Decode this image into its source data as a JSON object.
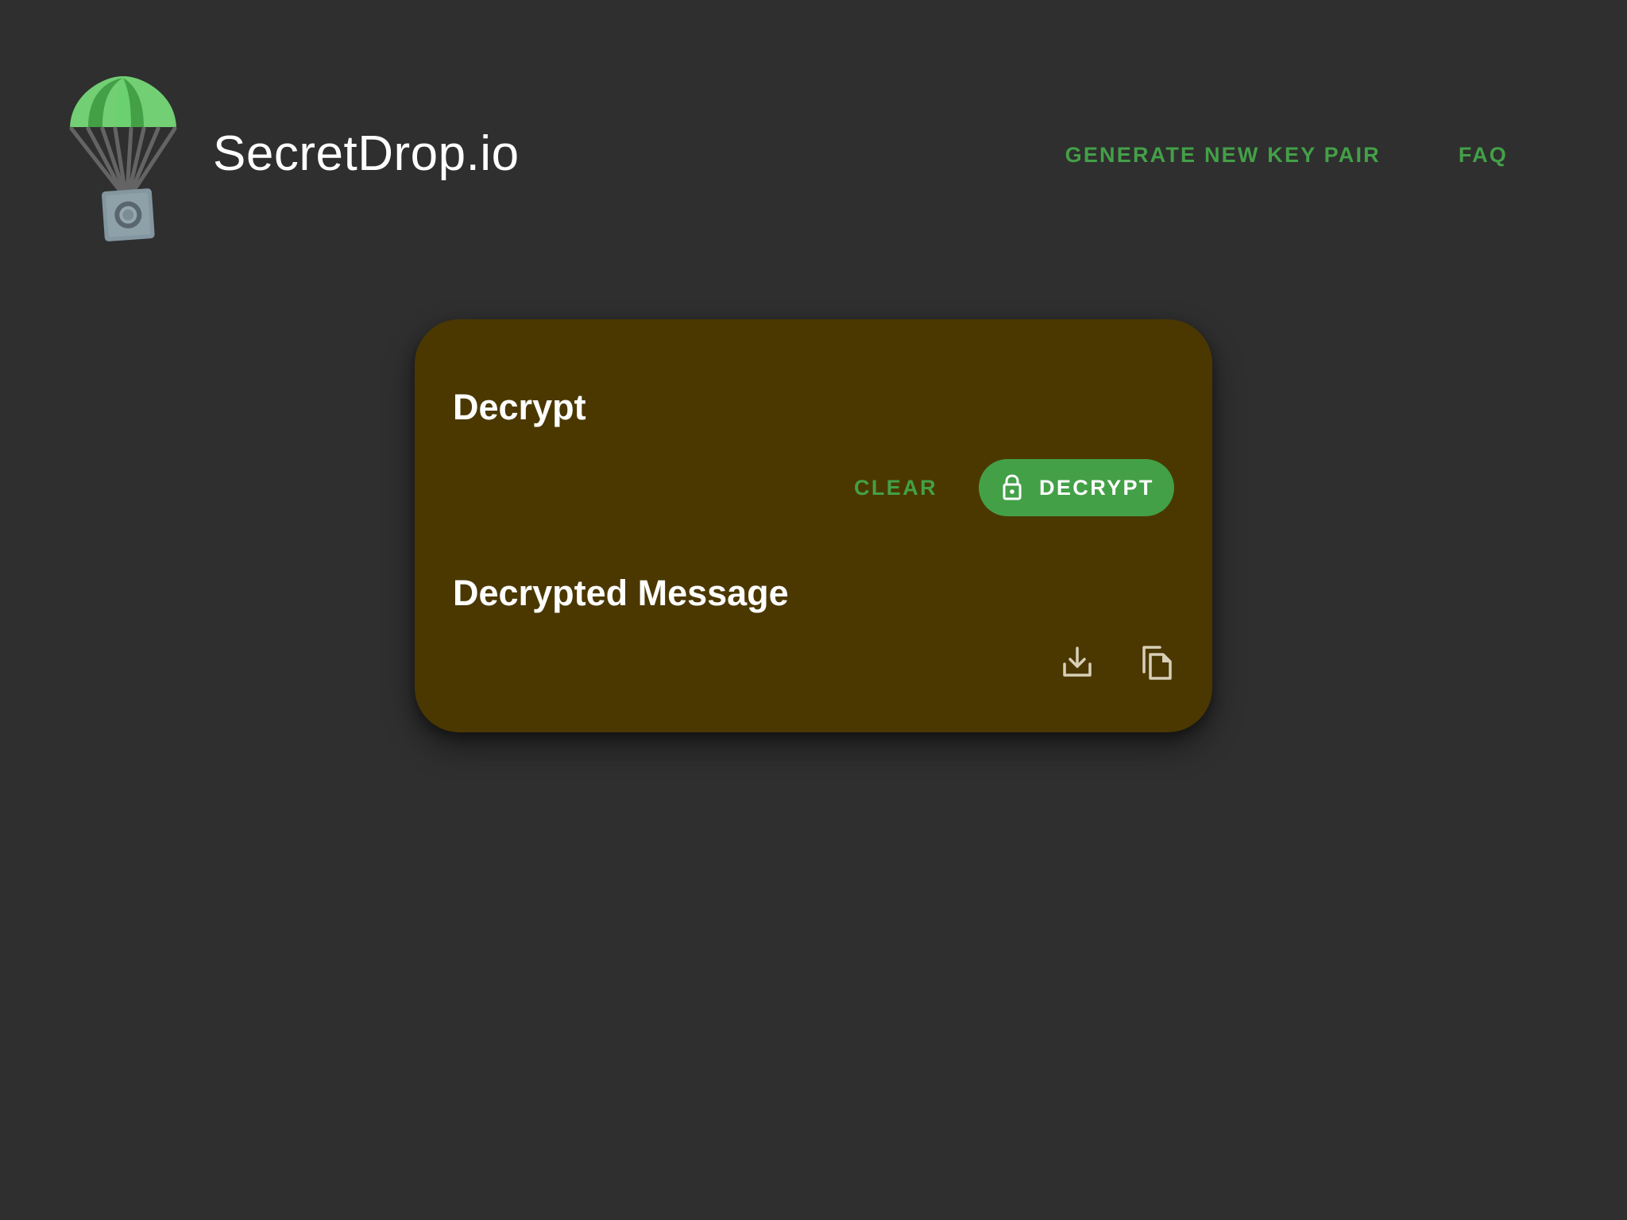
{
  "app": {
    "title": "SecretDrop.io",
    "logo_icon": "parachute-safe-icon"
  },
  "nav": {
    "items": [
      {
        "label": "GENERATE NEW KEY PAIR"
      },
      {
        "label": "FAQ"
      }
    ]
  },
  "card": {
    "decrypt_title": "Decrypt",
    "decrypted_title": "Decrypted Message",
    "clear_label": "CLEAR",
    "decrypt_label": "DECRYPT",
    "decrypt_icon": "lock-icon",
    "download_icon": "download-icon",
    "copy_icon": "copy-icon"
  },
  "colors": {
    "background": "#2f2f2f",
    "card_background": "#4b3800",
    "accent_green": "#43a047",
    "text_primary": "#ffffff",
    "icon_light": "#d8cfb7"
  }
}
